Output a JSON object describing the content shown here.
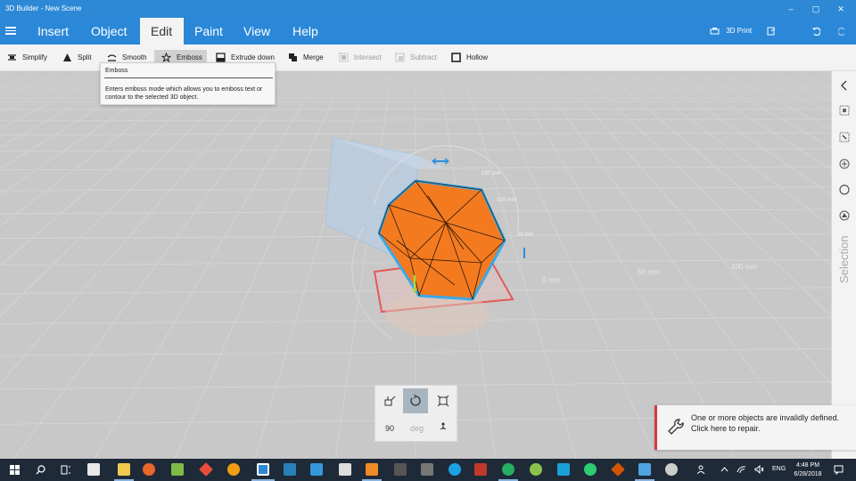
{
  "window": {
    "title": "3D Builder - New Scene",
    "minimize": "–",
    "maximize": "▢",
    "close": "✕"
  },
  "menubar": {
    "tabs": [
      "Insert",
      "Object",
      "Edit",
      "Paint",
      "View",
      "Help"
    ],
    "active_tab": "Edit",
    "print_label": "3D Print"
  },
  "ribbon": {
    "items": [
      {
        "label": "Simplify",
        "icon": "simplify-icon",
        "enabled": true
      },
      {
        "label": "Split",
        "icon": "split-icon",
        "enabled": true
      },
      {
        "label": "Smooth",
        "icon": "smooth-icon",
        "enabled": true
      },
      {
        "label": "Emboss",
        "icon": "star-icon",
        "enabled": true,
        "pressed": true
      },
      {
        "label": "Extrude down",
        "icon": "extrude-icon",
        "enabled": true
      },
      {
        "label": "Merge",
        "icon": "merge-icon",
        "enabled": true
      },
      {
        "label": "Intersect",
        "icon": "intersect-icon",
        "enabled": false
      },
      {
        "label": "Subtract",
        "icon": "subtract-icon",
        "enabled": false
      },
      {
        "label": "Hollow",
        "icon": "hollow-icon",
        "enabled": true
      }
    ]
  },
  "tooltip": {
    "title": "Emboss",
    "description": "Enters emboss mode which allows you to emboss text or contour to the selected 3D object."
  },
  "viewport": {
    "grid_labels": [
      "0 mm",
      "50 mm",
      "100 mm"
    ],
    "ruler_labels": [
      "50 mm",
      "100 mm",
      "150 mm"
    ],
    "object_color": "#f47a20",
    "outline_color": "#3aa9e6"
  },
  "side_panel": {
    "label": "Selection"
  },
  "transform_tools": {
    "angle_value": "90",
    "angle_unit": "deg"
  },
  "notification": {
    "message": "One or more objects are invalidly defined. Click here to repair."
  },
  "taskbar": {
    "time": "4:48 PM",
    "date": "6/28/2018",
    "language": "ENG"
  }
}
